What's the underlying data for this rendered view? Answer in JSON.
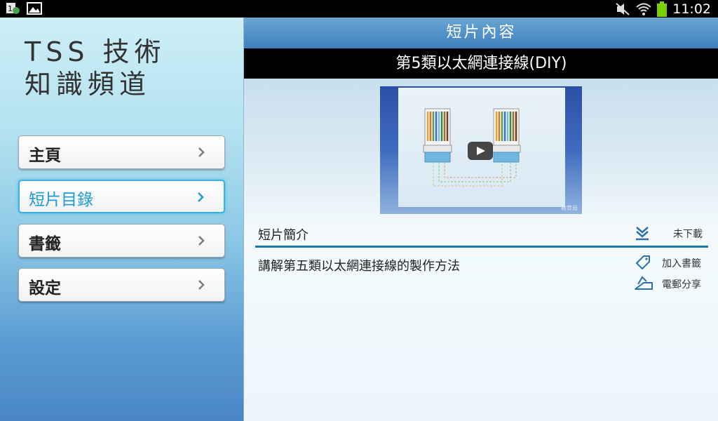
{
  "status_bar": {
    "time": "11:02",
    "icons_left": [
      "notification-app-icon",
      "gallery-icon"
    ],
    "icons_right": [
      "mute-icon",
      "wifi-icon",
      "battery-icon"
    ]
  },
  "app": {
    "title_line1": "TSS 技術",
    "title_line2": "知識頻道"
  },
  "nav": {
    "items": [
      {
        "label": "主頁",
        "active": false
      },
      {
        "label": "短片目錄",
        "active": true
      },
      {
        "label": "書籤",
        "active": false
      },
      {
        "label": "設定",
        "active": false
      }
    ]
  },
  "panel": {
    "header": "短片內容",
    "video_title": "第5類以太網連接線(DIY)",
    "thumbnail_watermark": "教育局",
    "section_label": "短片簡介",
    "download_status": "未下載",
    "description": "講解第五類以太網連接線的製作方法",
    "bookmark_label": "加入書籤",
    "share_label": "電郵分享"
  },
  "colors": {
    "accent": "#36b3e6",
    "header_bg": "#4f8fc6",
    "divider": "#1c7aa6",
    "battery": "#7cd000"
  }
}
